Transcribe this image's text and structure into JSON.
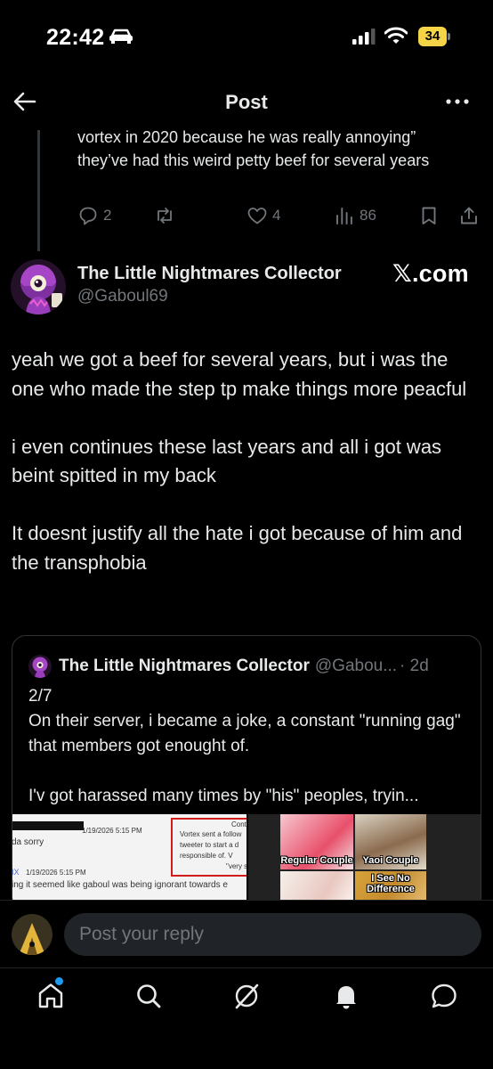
{
  "status_bar": {
    "time": "22:42",
    "battery": "34"
  },
  "header": {
    "title": "Post"
  },
  "parent_tweet": {
    "text": "vortex in 2020 because he was really annoying” they’ve had this weird petty beef for several years",
    "replies": "2",
    "likes": "4",
    "views": "86"
  },
  "tweet": {
    "author_name": "The Little Nightmares Collector",
    "author_handle": "@Gaboul69",
    "source_badge": "𝕏.com",
    "paragraphs": [
      "yeah we got a beef for several years, but i was the one who made the step tp make things more peacful",
      "i even continues these last years and all i got was beint spitted in my back",
      "It doesnt justify all the hate i got because of him and the transphobia"
    ]
  },
  "quote": {
    "author_name": "The Little Nightmares Collector",
    "author_handle": "@Gabou...",
    "time": "· 2d",
    "paragraphs": [
      "2/7\nOn their server, i became a joke, a constant \"running gag\" that members got enought of.",
      "I'v got harassed many times by \"his\" peoples, tryin..."
    ],
    "media_left": {
      "timestamp_1": "1/19/2026 5:15 PM",
      "line_1": "da sorry",
      "user_2": "IX",
      "timestamp_2": "1/19/2026 5:15 PM",
      "line_2": "ing it seemed like gaboul was being ignorant towards e",
      "box_title": "Cont",
      "box_line_1": "Vortex sent a follow",
      "box_line_2": "tweeter to start a d",
      "box_line_3": "responsible of. V",
      "box_line_4": "\"very sat"
    },
    "media_right": {
      "label_1": "Regular Couple",
      "label_2": "Yaoi Couple",
      "label_3": "I See No Difference"
    }
  },
  "reply": {
    "placeholder": "Post your reply"
  },
  "colors": {
    "background": "#000000",
    "text": "#e7e9ea",
    "muted": "#71767b",
    "accent": "#1d9bf0",
    "battery": "#f5d547"
  }
}
